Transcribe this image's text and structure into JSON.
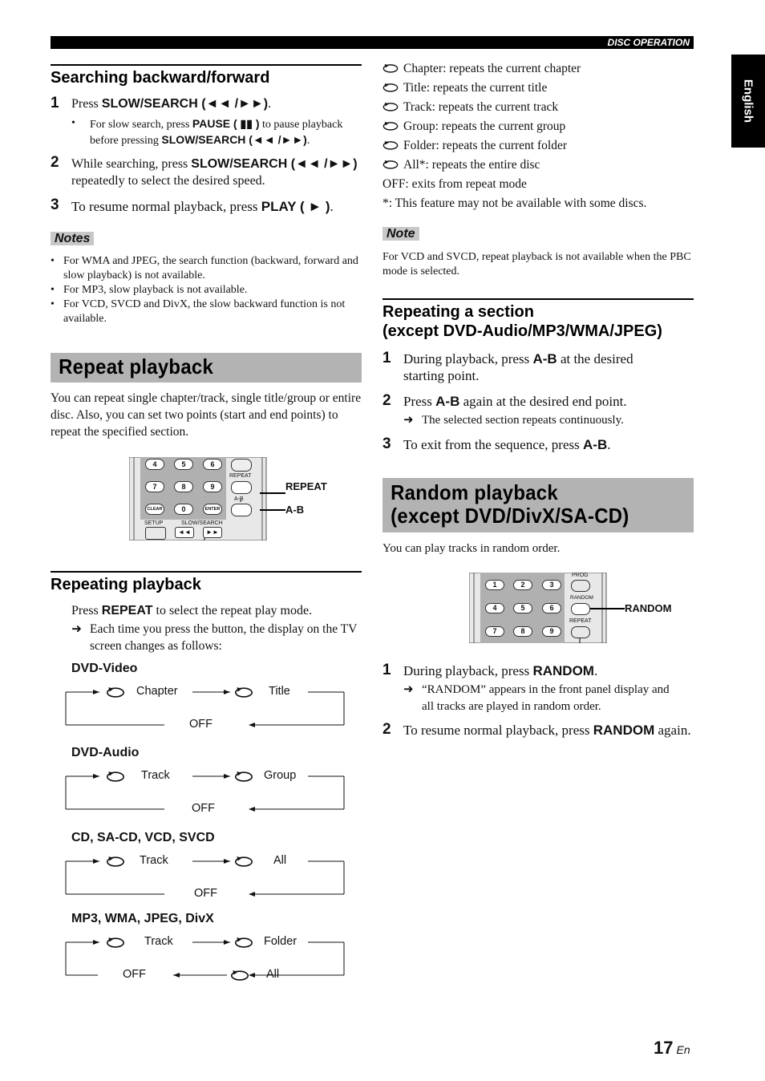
{
  "header": {
    "section_label": "DISC OPERATION",
    "language_tab": "English"
  },
  "searching": {
    "title": "Searching backward/forward",
    "steps": [
      {
        "num": "1",
        "pre": "Press ",
        "key": "SLOW/SEARCH (◄◄ /►►)",
        "post": ".",
        "sub_pre": "For slow search, press ",
        "sub_key1": "PAUSE ( ▮▮ )",
        "sub_mid": " to pause playback before pressing ",
        "sub_key2": "SLOW/SEARCH (◄◄ /►►)",
        "sub_post": "."
      },
      {
        "num": "2",
        "pre": "While searching, press ",
        "key": "SLOW/SEARCH (◄◄ /►►)",
        "post": " repeatedly to select the desired speed."
      },
      {
        "num": "3",
        "pre": "To resume normal playback, press ",
        "key": "PLAY ( ► )",
        "post": "."
      }
    ],
    "notes_label": "Notes",
    "notes": [
      "For WMA and JPEG, the search function (backward, forward and slow playback) is not available.",
      "For MP3, slow playback is not available.",
      "For VCD, SVCD and DivX, the slow backward function is not available."
    ]
  },
  "repeat_playback": {
    "title": "Repeat playback",
    "intro": "You can repeat single chapter/track, single title/group or entire disc. Also, you can set two points (start and end points) to repeat the specified section.",
    "remote": {
      "keys": [
        "4",
        "5",
        "6",
        "7",
        "8",
        "9",
        "CLEAR",
        "0",
        "ENTER"
      ],
      "repeat_label": "REPEAT",
      "ab_label": "A-B",
      "setup_label": "SETUP",
      "slow_label": "SLOW/SEARCH",
      "callout_repeat": "REPEAT",
      "callout_ab": "A-B"
    }
  },
  "repeating_playback": {
    "title": "Repeating playback",
    "press_pre": "Press ",
    "press_key": "REPEAT",
    "press_post": " to select the repeat play mode.",
    "arrow_text": "Each time you press the button, the display on the TV screen changes as follows:",
    "flows": [
      {
        "label": "DVD-Video",
        "a": "Chapter",
        "b": "Title",
        "off": "OFF"
      },
      {
        "label": "DVD-Audio",
        "a": "Track",
        "b": "Group",
        "off": "OFF"
      },
      {
        "label": "CD, SA-CD, VCD, SVCD",
        "a": "Track",
        "b": "All",
        "off": "OFF"
      },
      {
        "label": "MP3, WMA, JPEG, DivX",
        "a": "Track",
        "b": "Folder",
        "c": "All",
        "off": "OFF"
      }
    ]
  },
  "modes": {
    "items": [
      "Chapter: repeats the current chapter",
      "Title: repeats the current title",
      "Track: repeats the current track",
      "Group: repeats the current group",
      "Folder: repeats the current folder",
      "All*: repeats the entire disc"
    ],
    "off": "OFF: exits from repeat mode",
    "footnote": "*: This feature may not be available with some discs.",
    "note_label": "Note",
    "note": "For VCD and SVCD, repeat playback is not available when the PBC mode is selected."
  },
  "section_repeat": {
    "title_line1": "Repeating a section",
    "title_line2": "(except DVD-Audio/MP3/WMA/JPEG)",
    "step1_pre": "During playback, press ",
    "step1_key": "A-B",
    "step1_post": " at the desired starting point.",
    "step2_pre": "Press ",
    "step2_key": "A-B",
    "step2_post": " again at the desired end point.",
    "step2_result": "The selected section repeats continuously.",
    "step3_pre": "To exit from the sequence, press ",
    "step3_key": "A-B",
    "step3_post": "."
  },
  "random": {
    "title_line1": "Random playback",
    "title_line2": "(except DVD/DivX/SA-CD)",
    "intro": "You can play tracks in random order.",
    "remote": {
      "keys": [
        "1",
        "2",
        "3",
        "4",
        "5",
        "6",
        "7",
        "8",
        "9"
      ],
      "prog_label": "PROG",
      "random_label": "RANDOM",
      "repeat_label": "REPEAT",
      "callout": "RANDOM"
    },
    "step1_pre": "During playback, press ",
    "step1_key": "RANDOM",
    "step1_post": ".",
    "step1_result": "“RANDOM” appears in the front panel display and all tracks are played in random order.",
    "step2_pre": "To resume normal playback, press ",
    "step2_key": "RANDOM",
    "step2_post": " again."
  },
  "footer": {
    "page_number": "17",
    "lang_code": "En"
  }
}
